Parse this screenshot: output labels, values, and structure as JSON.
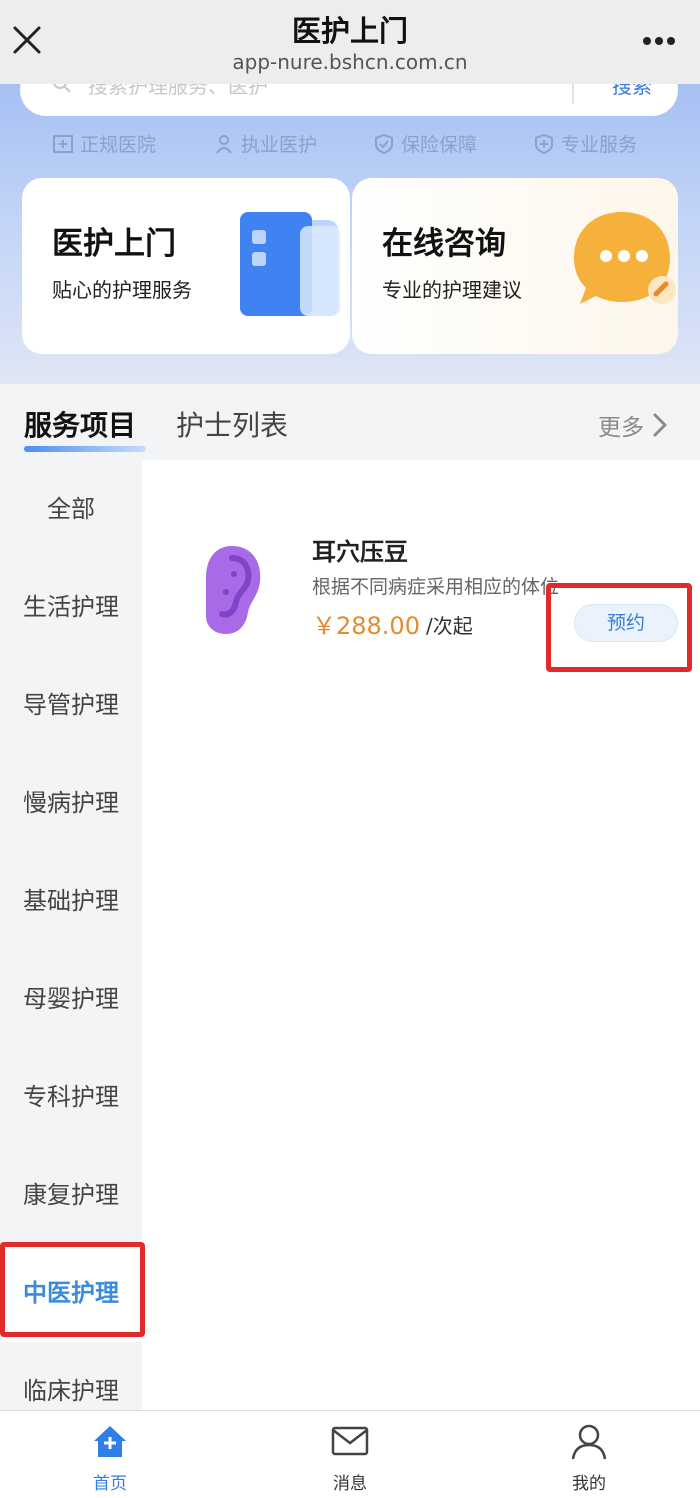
{
  "topbar": {
    "title": "医护上门",
    "url": "app-nure.bshcn.com.cn"
  },
  "search": {
    "placeholder": "搜索护理服务、医护",
    "button": "搜索"
  },
  "badges": [
    {
      "label": "正规医院",
      "icon": "hospital-icon"
    },
    {
      "label": "执业医护",
      "icon": "nurse-icon"
    },
    {
      "label": "保险保障",
      "icon": "shield-check-icon"
    },
    {
      "label": "专业服务",
      "icon": "shield-plus-icon"
    }
  ],
  "cards": [
    {
      "title": "医护上门",
      "subtitle": "贴心的护理服务",
      "icon": "building-icon"
    },
    {
      "title": "在线咨询",
      "subtitle": "专业的护理建议",
      "icon": "chat-bubble-icon"
    }
  ],
  "tabs": {
    "services": "服务项目",
    "nurses": "护士列表",
    "more": "更多"
  },
  "categories": [
    {
      "label": "全部"
    },
    {
      "label": "生活护理"
    },
    {
      "label": "导管护理"
    },
    {
      "label": "慢病护理"
    },
    {
      "label": "基础护理"
    },
    {
      "label": "母婴护理"
    },
    {
      "label": "专科护理"
    },
    {
      "label": "康复护理"
    },
    {
      "label": "中医护理"
    },
    {
      "label": "临床护理"
    }
  ],
  "active_category": "中医护理",
  "services": [
    {
      "name": "耳穴压豆",
      "description": "根据不同病症采用相应的体位",
      "price": "￥288.00",
      "unit": "/次起",
      "book_label": "预约",
      "icon": "ear-icon"
    }
  ],
  "bottom_nav": [
    {
      "label": "首页",
      "icon": "home-icon",
      "active": true
    },
    {
      "label": "消息",
      "icon": "mail-icon",
      "active": false
    },
    {
      "label": "我的",
      "icon": "user-icon",
      "active": false
    }
  ],
  "colors": {
    "accent": "#3a8be0",
    "price": "#e58a2d",
    "highlight": "#e02b2b"
  }
}
